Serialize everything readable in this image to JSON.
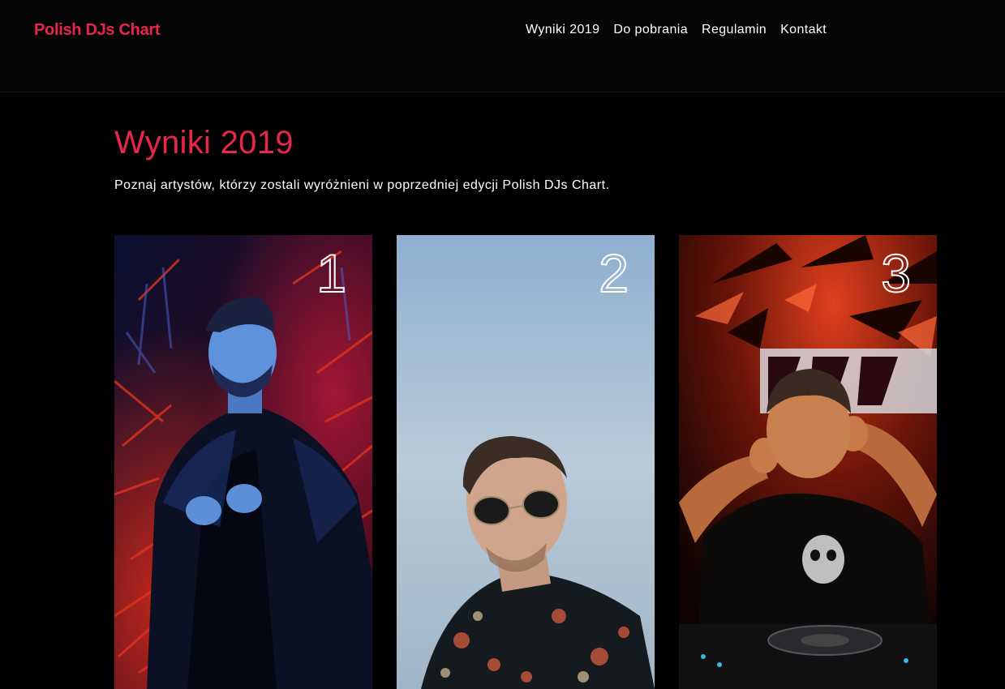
{
  "header": {
    "logo": "Polish DJs Chart",
    "nav": [
      {
        "label": "Wyniki 2019"
      },
      {
        "label": "Do pobrania"
      },
      {
        "label": "Regulamin"
      },
      {
        "label": "Kontakt"
      }
    ]
  },
  "main": {
    "title": "Wyniki 2019",
    "intro": "Poznaj artystów, którzy zostali wyróżnieni w poprzedniej edycji Polish DJs Chart.",
    "cards": [
      {
        "rank": "1"
      },
      {
        "rank": "2"
      },
      {
        "rank": "3"
      }
    ]
  },
  "colors": {
    "accent": "#e8264a",
    "background": "#000000",
    "text": "#ffffff"
  }
}
